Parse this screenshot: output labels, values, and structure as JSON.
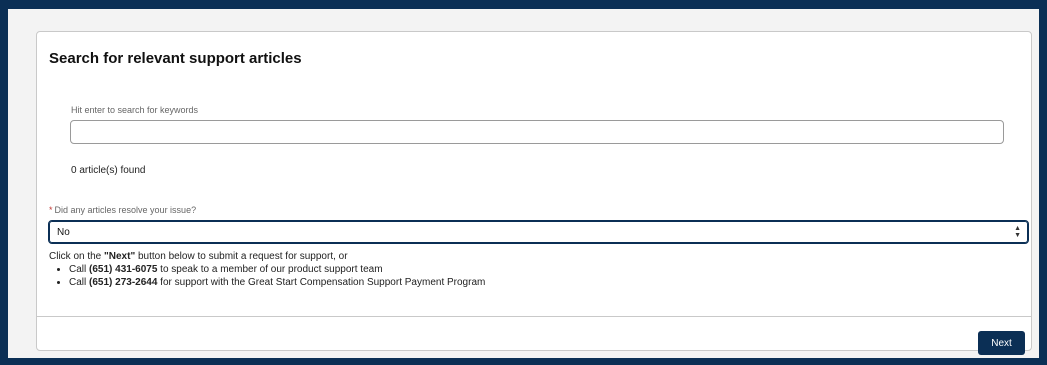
{
  "search": {
    "title": "Search for relevant support articles",
    "keyword_label": "Hit enter to search for keywords",
    "keyword_value": "",
    "results_count": "0 article(s) found"
  },
  "question": {
    "required_marker": "*",
    "label": "Did any articles resolve your issue?",
    "selected": "No"
  },
  "info": {
    "intro_prefix": "Click on the ",
    "intro_bold": "\"Next\"",
    "intro_suffix": " button below to submit a request for support, or",
    "items": [
      {
        "prefix": "Call ",
        "phone": "(651) 431-6075",
        "suffix": "  to speak to a member of our product support team"
      },
      {
        "prefix": "Call ",
        "phone": "(651) 273-2644",
        "suffix": " for support with the Great Start Compensation Support Payment Program"
      }
    ]
  },
  "actions": {
    "next_label": "Next"
  },
  "colors": {
    "brand": "#0b2f55",
    "required": "#c23934"
  }
}
